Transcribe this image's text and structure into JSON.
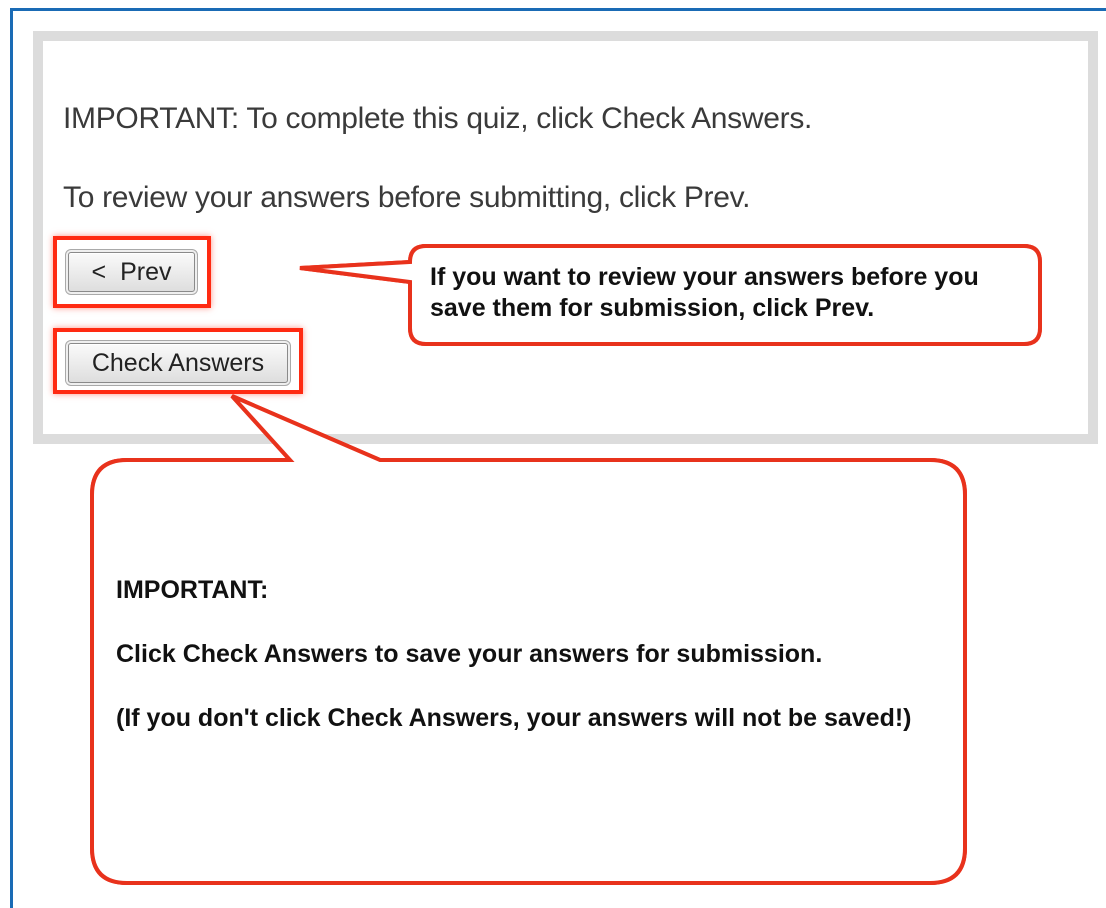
{
  "quiz": {
    "message_complete": "IMPORTANT: To complete this quiz, click Check Answers.",
    "message_review": "To review your answers before submitting, click Prev.",
    "prev_icon": "<",
    "prev_label": "Prev",
    "check_label": "Check Answers"
  },
  "callouts": {
    "prev_tip": "If you want to review your answers before you save them for submission, click Prev.",
    "check_heading": "IMPORTANT:",
    "check_line1": "Click Check Answers to save your answers for submission.",
    "check_line2": "(If you don't click Check Answers, your answers will not be saved!)"
  },
  "colors": {
    "highlight": "#ff2a12",
    "frame": "#1a6bb5",
    "panel_border": "#dcdcdc"
  }
}
